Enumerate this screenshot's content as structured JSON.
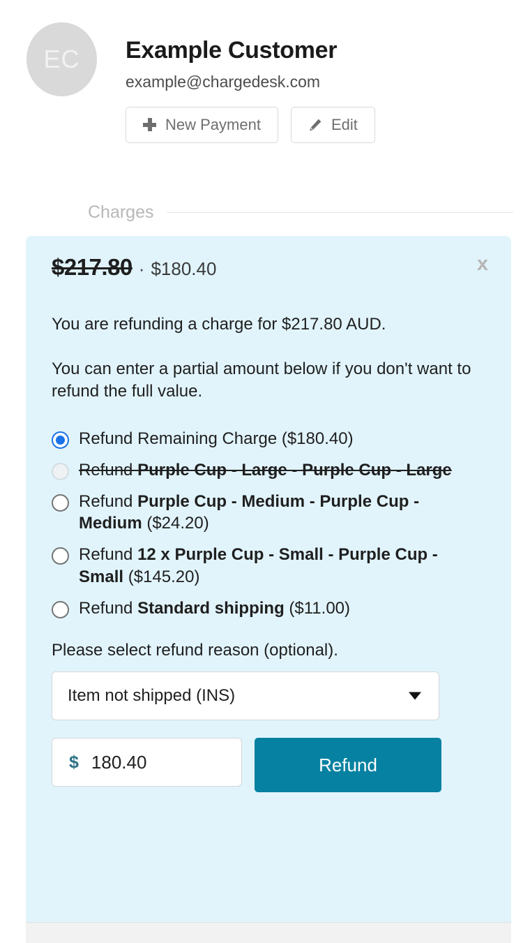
{
  "customer": {
    "avatar_initials": "EC",
    "name": "Example Customer",
    "email": "example@chargedesk.com",
    "new_payment_label": "New Payment",
    "edit_label": "Edit"
  },
  "section": {
    "charges_label": "Charges"
  },
  "refund_panel": {
    "original_amount": "$217.80",
    "separator": "·",
    "remaining_amount": "$180.40",
    "close_label": "x",
    "info_line_1": "You are refunding a charge for $217.80 AUD.",
    "info_line_2": "You can enter a partial amount below if you don't want to refund the full value.",
    "options": [
      {
        "prefix": "Refund ",
        "item": "Remaining Charge",
        "suffix": " ($180.40)",
        "bold_item": false,
        "selected": true,
        "disabled": false
      },
      {
        "prefix": "Refund ",
        "item": "Purple Cup - Large - Purple Cup - Large",
        "suffix": "",
        "bold_item": true,
        "selected": false,
        "disabled": true
      },
      {
        "prefix": "Refund ",
        "item": "Purple Cup - Medium - Purple Cup - Medium",
        "suffix": " ($24.20)",
        "bold_item": true,
        "selected": false,
        "disabled": false
      },
      {
        "prefix": "Refund ",
        "item": "12 x Purple Cup - Small - Purple Cup - Small",
        "suffix": " ($145.20)",
        "bold_item": true,
        "selected": false,
        "disabled": false
      },
      {
        "prefix": "Refund ",
        "item": "Standard shipping",
        "suffix": " ($11.00)",
        "bold_item": true,
        "selected": false,
        "disabled": false
      }
    ],
    "reason_label": "Please select refund reason (optional).",
    "reason_selected": "Item not shipped (INS)",
    "amount_currency_symbol": "$",
    "amount_value": "180.40",
    "refund_button_label": "Refund"
  },
  "colors": {
    "panel_background": "#e1f4fc",
    "refund_button": "#0781a1",
    "selected_radio": "#1a73e8",
    "avatar_background": "#d9d9d9",
    "currency_symbol": "#2d7185",
    "muted_text": "#b8b8b8"
  }
}
